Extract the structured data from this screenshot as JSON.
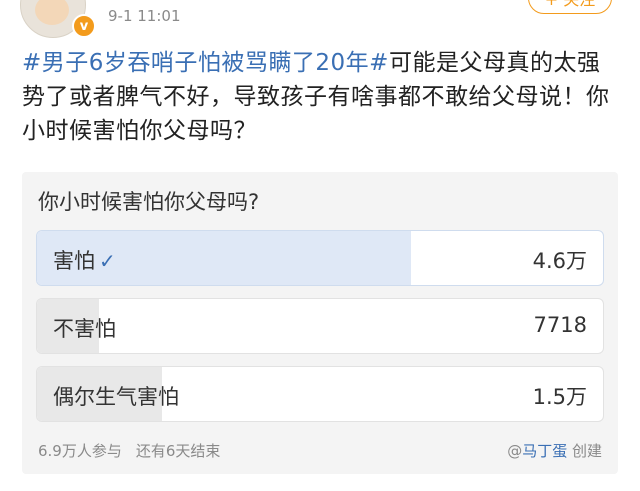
{
  "header": {
    "timestamp": "9-1 11:01",
    "follow_label": "+ 关注",
    "verified_badge": "v"
  },
  "post": {
    "hashtag": "#男子6岁吞哨子怕被骂瞒了20年#",
    "body": "可能是父母真的太强势了或者脾气不好，导致孩子有啥事都不敢给父母说！你小时候害怕你父母吗？"
  },
  "poll": {
    "question": "你小时候害怕你父母吗?",
    "options": [
      {
        "label": "害怕",
        "count": "4.6万",
        "share": 0.67,
        "selected": true
      },
      {
        "label": "不害怕",
        "count": "7718",
        "share": 0.11,
        "selected": false
      },
      {
        "label": "偶尔生气害怕",
        "count": "1.5万",
        "share": 0.22,
        "selected": false
      }
    ],
    "participants": "6.9万人参与",
    "remaining": "还有6天结束",
    "creator_prefix": "@",
    "creator_name": "马丁蛋",
    "creator_suffix": "创建"
  },
  "colors": {
    "link": "#3a6fb4",
    "accent": "#f39b1c",
    "selected_fill": "#dfe8f6",
    "option_fill": "#e8e8e8"
  }
}
